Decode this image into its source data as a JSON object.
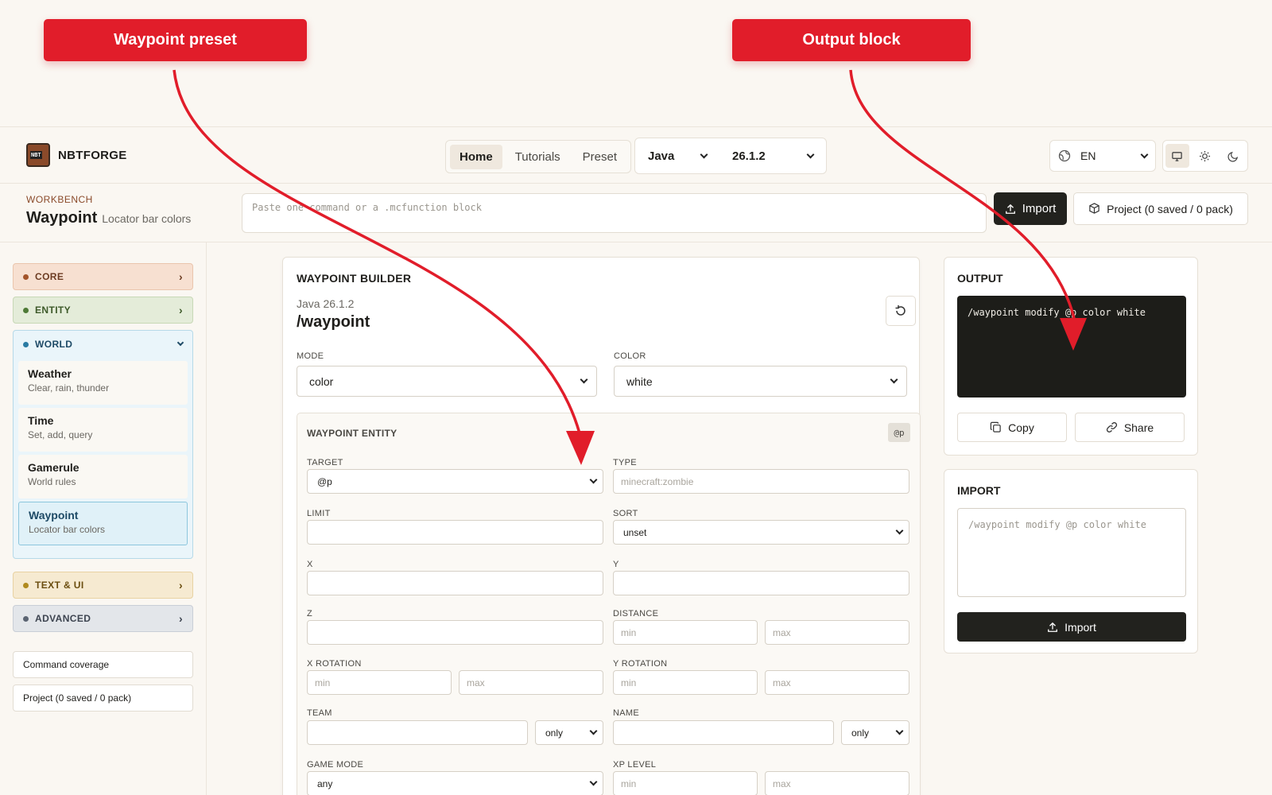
{
  "annotations": {
    "left_callout": "Waypoint preset",
    "right_callout": "Output block"
  },
  "header": {
    "brand": "NBTFORGE",
    "tabs": [
      "Home",
      "Tutorials",
      "Preset"
    ],
    "active_tab": "Home",
    "edition": "Java",
    "version": "26.1.2",
    "language": "EN"
  },
  "workbench": {
    "kicker": "WORKBENCH",
    "title": "Waypoint",
    "subtitle": "Locator bar colors",
    "paste_placeholder": "Paste one command or a .mcfunction block",
    "import_label": "Import",
    "project_label": "Project (0 saved / 0 pack)"
  },
  "sidebar": {
    "categories": {
      "core": "CORE",
      "entity": "ENTITY",
      "world": "WORLD",
      "text_ui": "TEXT & UI",
      "advanced": "ADVANCED"
    },
    "world_items": [
      {
        "title": "Weather",
        "subtitle": "Clear, rain, thunder"
      },
      {
        "title": "Time",
        "subtitle": "Set, add, query"
      },
      {
        "title": "Gamerule",
        "subtitle": "World rules"
      },
      {
        "title": "Waypoint",
        "subtitle": "Locator bar colors"
      }
    ],
    "coverage_link": "Command coverage",
    "project_link": "Project (0 saved / 0 pack)"
  },
  "builder": {
    "heading": "WAYPOINT BUILDER",
    "version_line": "Java 26.1.2",
    "command": "/waypoint",
    "mode_label": "MODE",
    "mode_value": "color",
    "color_label": "COLOR",
    "color_value": "white",
    "entity": {
      "heading": "WAYPOINT ENTITY",
      "badge": "@p",
      "target_label": "TARGET",
      "target_value": "@p",
      "type_label": "TYPE",
      "type_placeholder": "minecraft:zombie",
      "limit_label": "LIMIT",
      "sort_label": "SORT",
      "sort_value": "unset",
      "x_label": "X",
      "y_label": "Y",
      "z_label": "Z",
      "distance_label": "DISTANCE",
      "x_rotation_label": "X ROTATION",
      "y_rotation_label": "Y ROTATION",
      "team_label": "TEAM",
      "team_mode": "only",
      "name_label": "NAME",
      "name_mode": "only",
      "game_mode_label": "GAME MODE",
      "game_mode_value": "any",
      "xp_level_label": "XP LEVEL",
      "min_placeholder": "min",
      "max_placeholder": "max"
    }
  },
  "output": {
    "heading": "OUTPUT",
    "code": "/waypoint modify @p color white",
    "copy_label": "Copy",
    "share_label": "Share"
  },
  "import_panel": {
    "heading": "IMPORT",
    "placeholder": "/waypoint modify @p color white",
    "button_label": "Import"
  },
  "colors": {
    "annotation_red": "#e11d2a",
    "dark_button": "#22221e",
    "background": "#faf7f2"
  }
}
